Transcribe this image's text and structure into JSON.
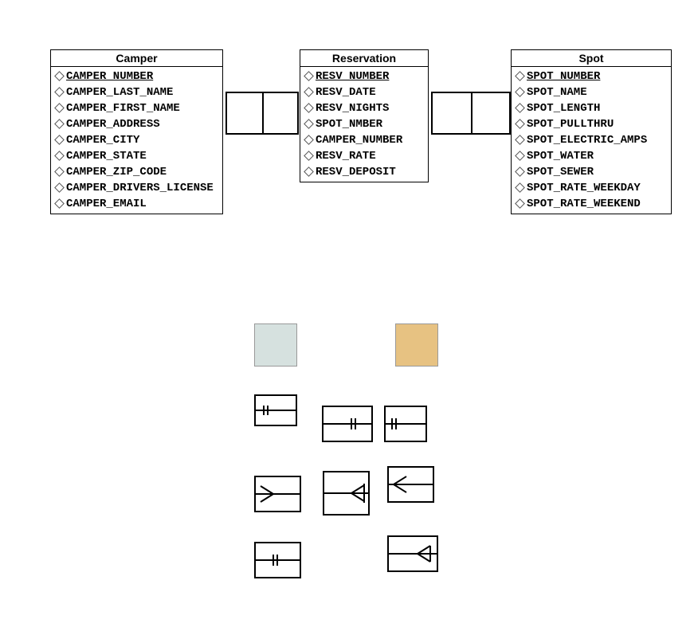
{
  "entities": {
    "camper": {
      "title": "Camper",
      "attrs": [
        "CAMPER_NUMBER",
        "CAMPER_LAST_NAME",
        "CAMPER_FIRST_NAME",
        "CAMPER_ADDRESS",
        "CAMPER_CITY",
        "CAMPER_STATE",
        "CAMPER_ZIP_CODE",
        "CAMPER_DRIVERS_LICENSE",
        "CAMPER_EMAIL"
      ],
      "pk": "CAMPER_NUMBER"
    },
    "reservation": {
      "title": "Reservation",
      "attrs": [
        "RESV_NUMBER",
        "RESV_DATE",
        "RESV_NIGHTS",
        "SPOT_NMBER",
        "CAMPER_NUMBER",
        "RESV_RATE",
        "RESV_DEPOSIT"
      ],
      "pk": "RESV_NUMBER"
    },
    "spot": {
      "title": "Spot",
      "attrs": [
        "SPOT_NUMBER",
        "SPOT_NAME",
        "SPOT_LENGTH",
        "SPOT_PULLTHRU",
        "SPOT_ELECTRIC_AMPS",
        "SPOT_WATER",
        "SPOT_SEWER",
        "SPOT_RATE_WEEKDAY",
        "SPOT_RATE_WEEKEND"
      ],
      "pk": "SPOT_NUMBER"
    }
  },
  "swatches": {
    "light": "#d6e1df",
    "tan": "#e7c282"
  }
}
